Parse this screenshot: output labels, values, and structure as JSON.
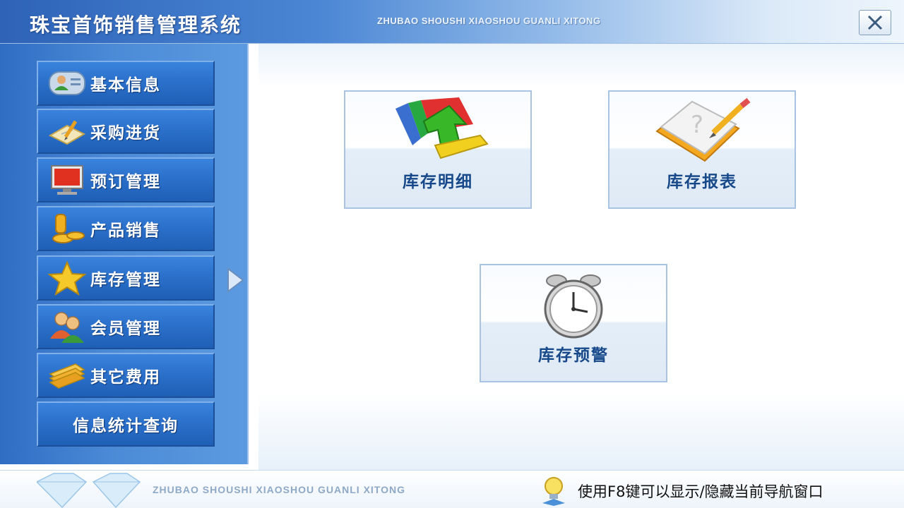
{
  "header": {
    "title": "珠宝首饰销售管理系统",
    "subtitle": "ZHUBAO SHOUSHI XIAOSHOU GUANLI XITONG",
    "close_icon": "close-icon"
  },
  "sidebar": {
    "items": [
      {
        "label": "基本信息",
        "icon": "contact-card-icon"
      },
      {
        "label": "采购进货",
        "icon": "notepad-pen-icon"
      },
      {
        "label": "预订管理",
        "icon": "monitor-icon"
      },
      {
        "label": "产品销售",
        "icon": "gold-coins-icon"
      },
      {
        "label": "库存管理",
        "icon": "star-icon"
      },
      {
        "label": "会员管理",
        "icon": "users-icon"
      },
      {
        "label": "其它费用",
        "icon": "folder-stack-icon"
      },
      {
        "label": "信息统计查询",
        "icon": ""
      }
    ],
    "expand_icon": "triangle-right-icon"
  },
  "main": {
    "tiles": [
      {
        "label": "库存明细",
        "icon": "colorful-arrow-icon"
      },
      {
        "label": "库存报表",
        "icon": "notebook-pencil-icon"
      },
      {
        "label": "库存预警",
        "icon": "alarm-clock-icon"
      }
    ]
  },
  "footer": {
    "brand": "ZHUBAO SHOUSHI XIAOSHOU GUANLI XITONG",
    "hint": "使用F8键可以显示/隐藏当前导航窗口",
    "logo_icon": "diamond-icon",
    "hint_icon": "lightbulb-icon"
  },
  "colors": {
    "sidebar_blue": "#2f6dc4",
    "button_blue": "#2a6fc9",
    "tile_label": "#17498a"
  }
}
